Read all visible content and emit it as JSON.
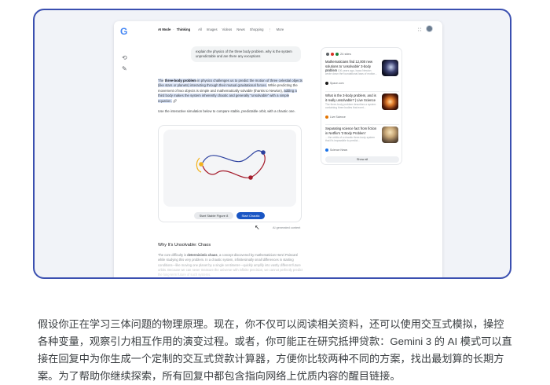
{
  "app": {
    "logo": "G",
    "nav": {
      "items": [
        "AI Mode",
        "Thinking",
        "All",
        "Images",
        "Videos",
        "News",
        "Shopping",
        "More"
      ]
    }
  },
  "chat": {
    "user_message": "explain the physics of the three body problem. why is the system unpredictable and are there any exceptions",
    "answer": {
      "intro": "The",
      "bold_term": "three-body problem",
      "part1": "in physics challenges us to predict the motion of three celestial objects (like stars or planets) interacting through their mutual gravitational forces.",
      "part2": "While predicting the movement of two objects is simple and mathematically solvable (thanks to Newton),",
      "part3": "adding a third body makes the system inherently chaotic and generally \"unsolvable\" with a simple equation."
    },
    "sim_intro": "Use the interactive simulation below to compare stable, predictable orbit, with a chaotic one.",
    "sim": {
      "stable_button": "Start Stable Figure 8",
      "chaotic_button": "Start Chaotic"
    },
    "ai_generated": "AI generated content",
    "section": {
      "title": "Why It's Unsolvable: Chaos",
      "text_pre": "The core difficulty is",
      "text_bold": "deterministic chaos",
      "text_post": ", a concept discovered by mathematician Henri Poincaré while studying this very problem. In a chaotic system, infinitesimally small differences in starting conditions—like moving one planet by a single centimeter—quickly amplify into vastly different future orbits. Because we can never measure the universe with infinite precision, we cannot perfectly predict the long-term future of such systems."
    }
  },
  "sources": {
    "views": "24 sites",
    "items": [
      {
        "title": "Mathematicians find 12,000 new solutions to 'unsolvable' 3-body problem",
        "snippet": "More than 100 years ago, Isaac Newton wrote down the foundational laws of motion...",
        "site": "Space.com"
      },
      {
        "title": "What is the 3-body problem, and is it really unsolvable? | Live Science",
        "snippet": "The three-body problem describes a system containing three bodies that exert...",
        "site": "Live Science"
      },
      {
        "title": "Separating science fact from fiction in Netflix's '3 Body Problem'",
        "snippet": "... the orbits of a chaotic three-body system that it's impossible to predict...",
        "site": "Science News"
      }
    ],
    "show_all": "Show all"
  },
  "caption": "假设你正在学习三体问题的物理原理。现在，你不仅可以阅读相关资料，还可以使用交互式模拟，操控各种变量，观察引力相互作用的演变过程。或者，你可能正在研究抵押贷款：Gemini 3 的 AI 模式可以直接在回复中为你生成一个定制的交互式贷款计算器，方便你比较两种不同的方案，找出最划算的长期方案。为了帮助你继续探索，所有回复中都包含指向网络上优质内容的醒目链接。",
  "colors": {
    "frame_border": "#3a4fb0",
    "accent_button": "#1a56c4",
    "highlight": "#d9e3f7",
    "orbit_blue": "#2a3f9e",
    "orbit_red": "#a51d2d",
    "orbit_yellow": "#f2b21c"
  }
}
